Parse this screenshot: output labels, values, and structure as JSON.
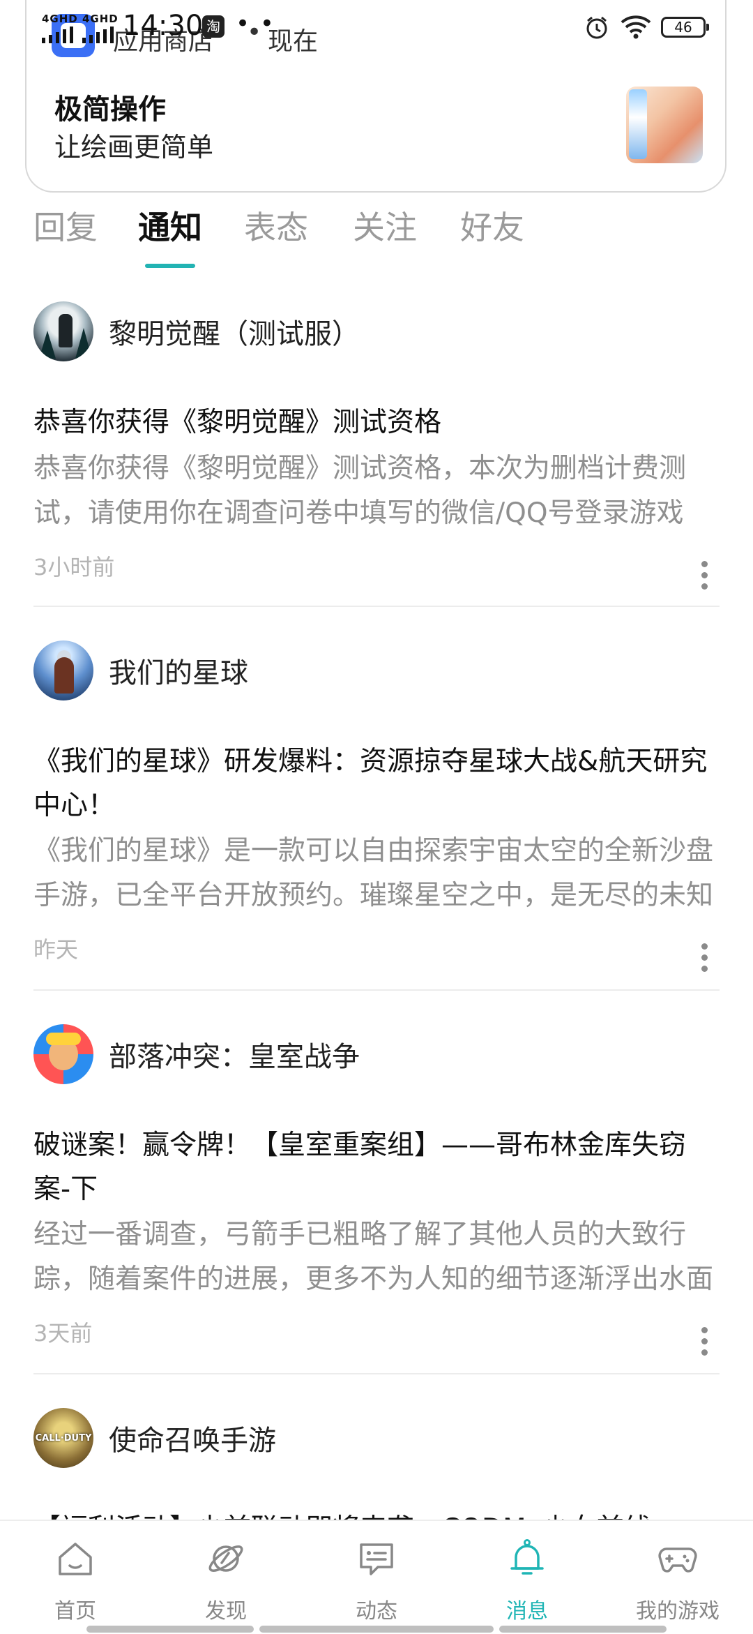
{
  "status_bar": {
    "network1": "4GHD",
    "network2": "4GHD",
    "time": "14:30",
    "notify_icon": "淘",
    "more_dots": "• •",
    "battery": "46"
  },
  "notification": {
    "app_name": "应用商店",
    "separator": "•",
    "time": "现在",
    "title": "极简操作",
    "text": "让绘画更简单"
  },
  "tabs": [
    {
      "label": "回复"
    },
    {
      "label": "通知"
    },
    {
      "label": "表态"
    },
    {
      "label": "关注"
    },
    {
      "label": "好友"
    }
  ],
  "active_tab": "通知",
  "accent_color": "#22b3b3",
  "feed": [
    {
      "source": "黎明觉醒（测试服）",
      "title": "恭喜你获得《黎明觉醒》测试资格",
      "body": "恭喜你获得《黎明觉醒》测试资格，本次为删档计费测试，请使用你在调查问卷中填写的微信/QQ号登录游戏",
      "time": "3小时前"
    },
    {
      "source": "我们的星球",
      "title": "《我们的星球》研发爆料：资源掠夺星球大战&航天研究中心！",
      "body": "《我们的星球》是一款可以自由探索宇宙太空的全新沙盘手游，已全平台开放预约。璀璨星空之中，是无尽的未知",
      "time": "昨天"
    },
    {
      "source": "部落冲突：皇室战争",
      "title": "破谜案！赢令牌！【皇室重案组】——哥布林金库失窃案-下",
      "body": "经过一番调查，弓箭手已粗略了解了其他人员的大致行踪，随着案件的进展，更多不为人知的细节逐渐浮出水面",
      "time": "3天前"
    },
    {
      "source": "使命召唤手游",
      "title": "【福利活动】少前联动即将来袭，CODMx少女前线",
      "avatar_text": "CALL·DUTY"
    }
  ],
  "bottom_nav": [
    {
      "label": "首页",
      "icon": "home-icon"
    },
    {
      "label": "发现",
      "icon": "planet-icon"
    },
    {
      "label": "动态",
      "icon": "message-icon"
    },
    {
      "label": "消息",
      "icon": "bell-icon"
    },
    {
      "label": "我的游戏",
      "icon": "gamepad-icon"
    }
  ]
}
